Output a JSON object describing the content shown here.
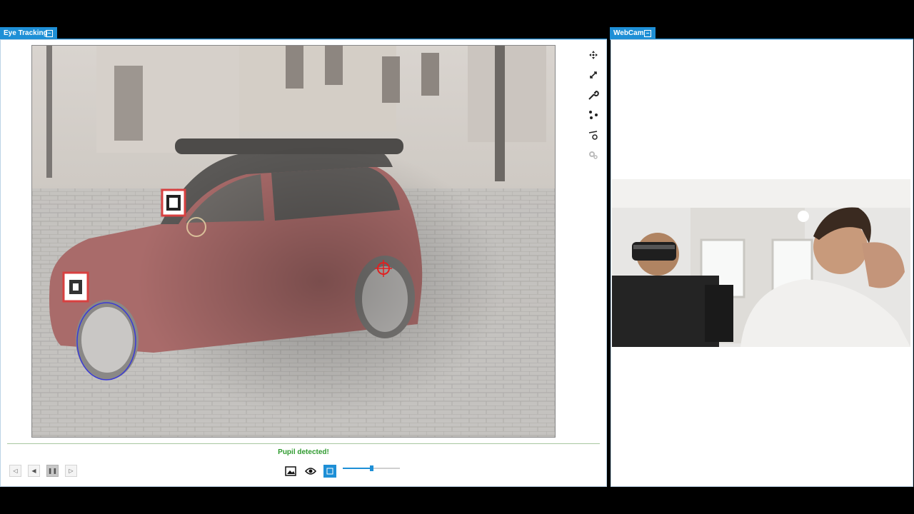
{
  "eye_tracking": {
    "tab_title": "Eye Tracking",
    "status": "Pupil detected!",
    "slider_value": 0.5
  },
  "webcam": {
    "tab_title": "WebCam"
  },
  "icons": {
    "toolbar": [
      "move-icon",
      "zoom-icon",
      "wrench-icon",
      "markers-icon",
      "calibrate-icon",
      "settings-icon"
    ],
    "playback": [
      "skip-back-icon",
      "step-back-icon",
      "pause-icon",
      "step-forward-icon"
    ],
    "view": [
      "image-icon",
      "eye-icon",
      "record-icon"
    ]
  },
  "colors": {
    "accent": "#1e8fd6",
    "status_ok": "#2e9a2e",
    "gaze_marker": "#e02020",
    "pupil_outline": "#3a3ad6"
  }
}
